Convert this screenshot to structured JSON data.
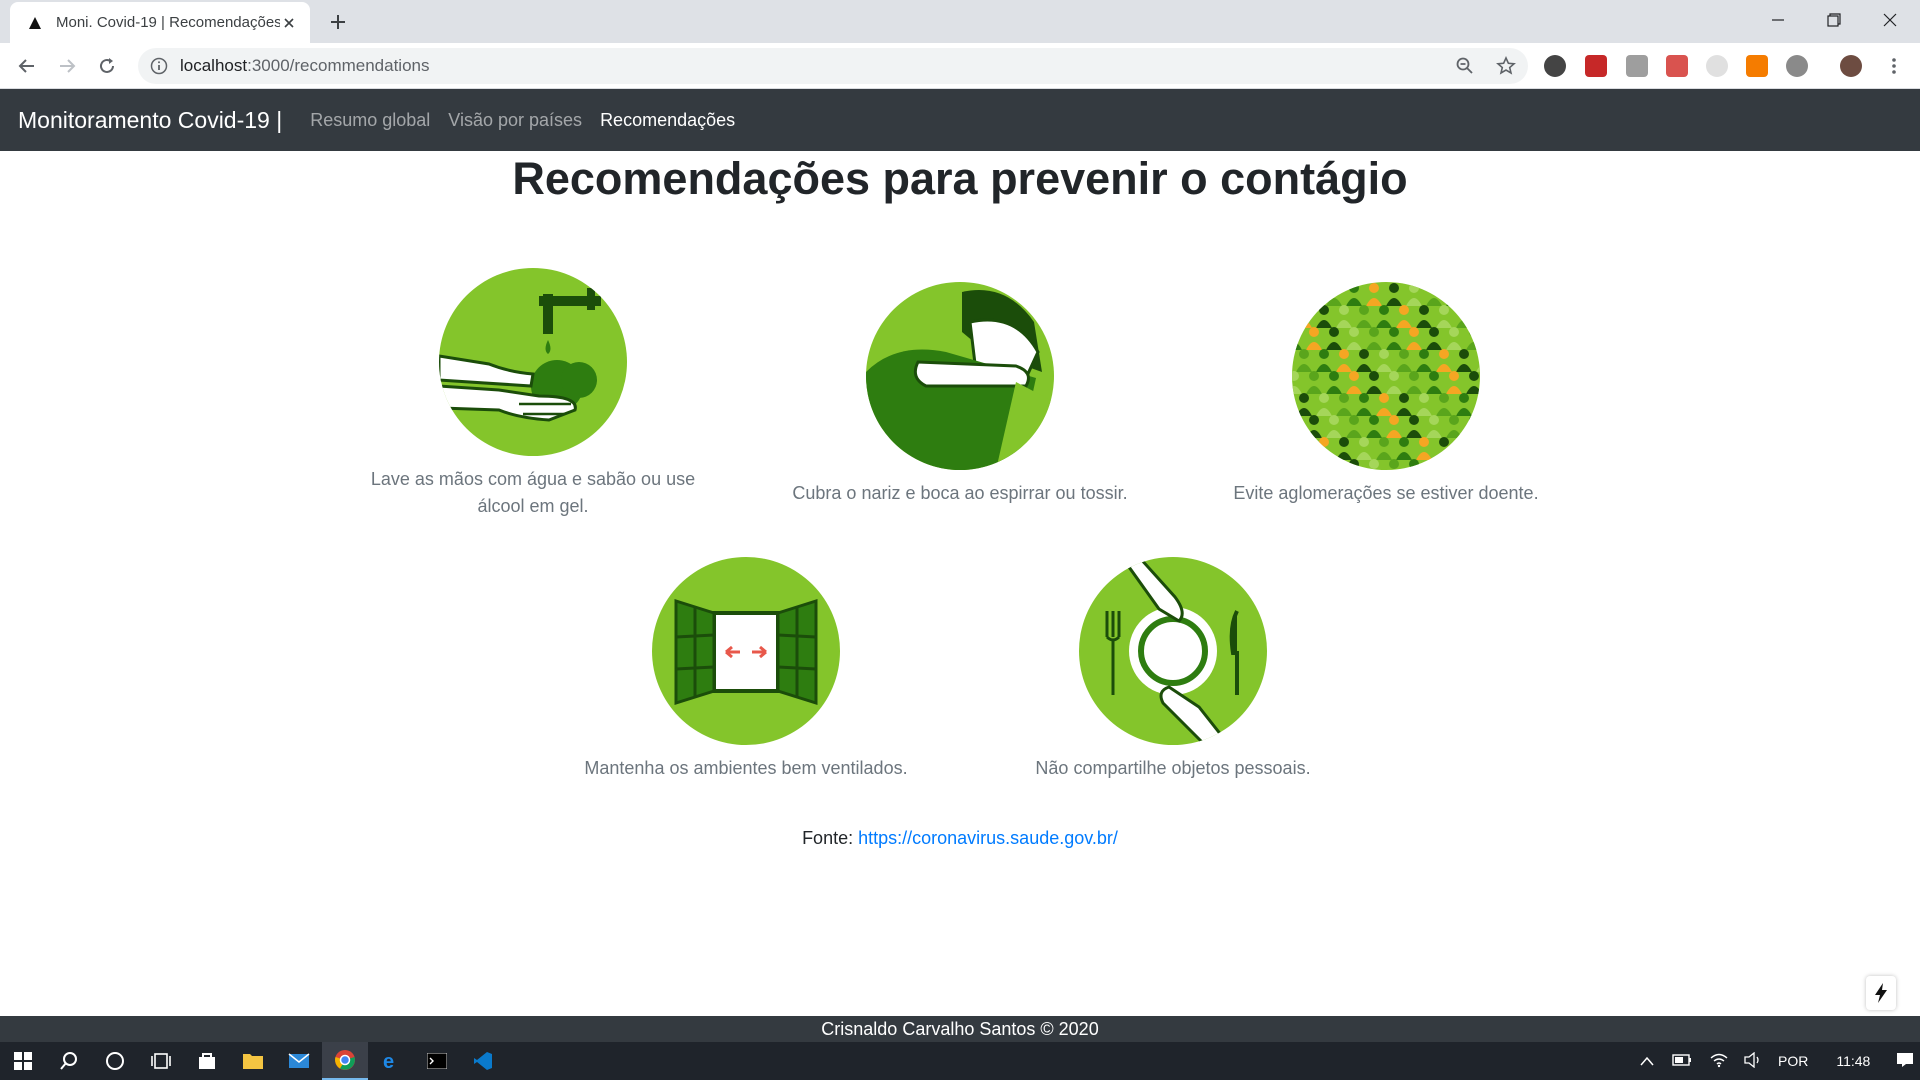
{
  "browser": {
    "tab_title": "Moni. Covid-19 | Recomendações",
    "url_host": "localhost",
    "url_path": ":3000/recommendations"
  },
  "navbar": {
    "brand": "Monitoramento Covid-19 |",
    "links": [
      "Resumo global",
      "Visão por países",
      "Recomendações"
    ],
    "active_index": 2
  },
  "page": {
    "title": "Recomendações para prevenir o contágio",
    "recommendations": [
      {
        "icon": "hand-washing-icon",
        "caption": "Lave as mãos com água e sabão ou use álcool em gel."
      },
      {
        "icon": "cough-elbow-icon",
        "caption": "Cubra o nariz e boca ao espirrar ou tossir."
      },
      {
        "icon": "crowd-icon",
        "caption": "Evite aglomerações se estiver doente."
      },
      {
        "icon": "open-window-icon",
        "caption": "Mantenha os ambientes bem ventilados."
      },
      {
        "icon": "no-sharing-plate-icon",
        "caption": "Não compartilhe objetos pessoais."
      }
    ],
    "source_label": "Fonte:",
    "source_url": "https://coronavirus.saude.gov.br/"
  },
  "footer": {
    "text": "Crisnaldo Carvalho Santos © 2020"
  },
  "taskbar": {
    "language": "POR",
    "time": "11:48"
  },
  "colors": {
    "navbar_bg": "#343a40",
    "icon_green": "#84c52b",
    "icon_dark_green": "#2e7d10",
    "link": "#007bff"
  }
}
